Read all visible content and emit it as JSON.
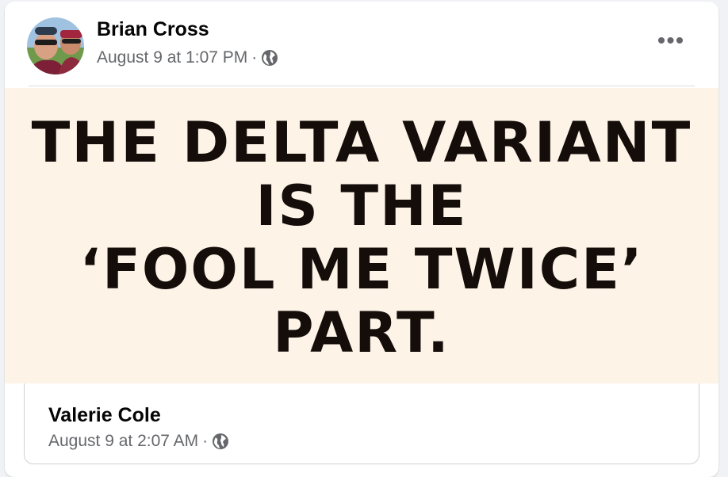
{
  "post": {
    "author": "Brian Cross",
    "timestamp": "August 9 at 1:07 PM",
    "separator": "·",
    "privacy_icon": "globe-icon",
    "more_icon": "•••"
  },
  "meme": {
    "lines": [
      "THE DELTA VARIANT",
      "IS THE",
      "‘FOOL ME TWICE’",
      "PART."
    ]
  },
  "shared_post": {
    "author": "Valerie Cole",
    "timestamp": "August 9 at 2:07 AM",
    "separator": "·",
    "privacy_icon": "globe-icon"
  },
  "colors": {
    "meme_background": "#fdf3e6",
    "meme_text": "#140d0a",
    "secondary_text": "#65676b"
  }
}
